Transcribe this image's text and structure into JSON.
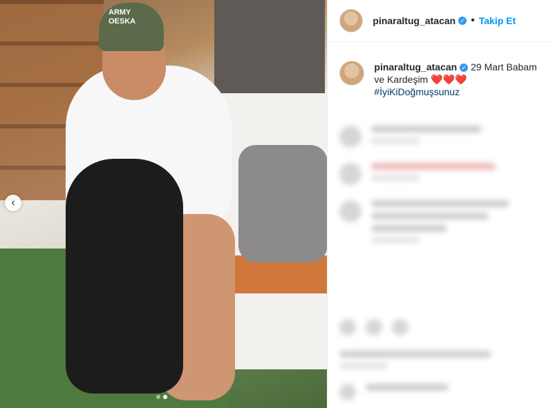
{
  "post": {
    "media": {
      "cap_text": "ARMY\nOESKA",
      "carousel": {
        "total_slides": 2,
        "active_slide": 2
      },
      "nav_left_glyph": "‹"
    },
    "header": {
      "username": "pinaraltug_atacan",
      "verified": true,
      "separator": "•",
      "follow_label": "Takip Et"
    },
    "caption": {
      "username": "pinaraltug_atacan",
      "text": "29 Mart Babam ve Kardeşim",
      "hearts": "❤️❤️❤️",
      "hashtag": "#İyiKiDoğmuşsunuz"
    },
    "colors": {
      "follow_blue": "#0095f6",
      "verified_blue": "#3897f0",
      "hashtag_blue": "#00376b"
    }
  }
}
